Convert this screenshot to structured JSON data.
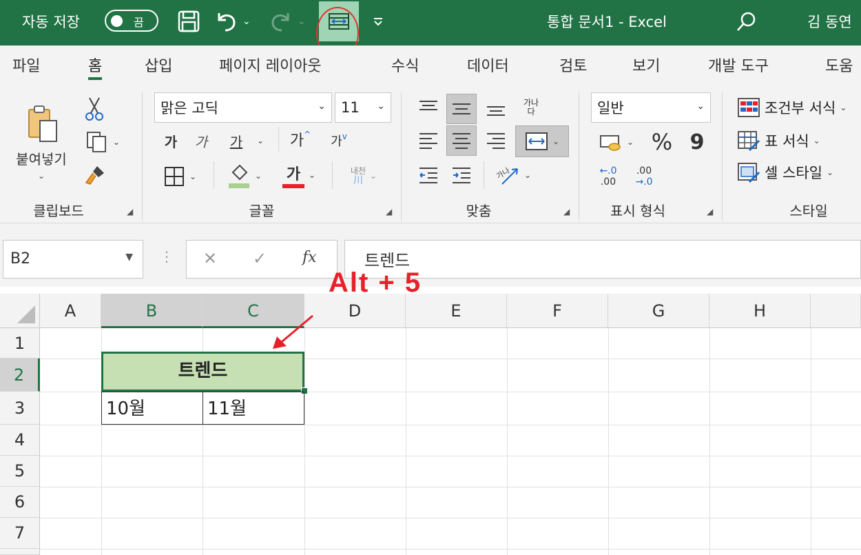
{
  "titlebar": {
    "autosave_label": "자동 저장",
    "autosave_state": "끔",
    "doc_title": "통합 문서1  -  Excel",
    "user_name": "김 동연",
    "icons": [
      "save-icon",
      "undo-icon",
      "redo-icon",
      "merge-center-icon",
      "customize-qat-icon",
      "search-icon"
    ]
  },
  "tabs": [
    "파일",
    "홈",
    "삽입",
    "페이지 레이아웃",
    "수식",
    "데이터",
    "검토",
    "보기",
    "개발 도구",
    "도움"
  ],
  "ribbon": {
    "clipboard": {
      "paste": "붙여넣기",
      "label": "클립보드"
    },
    "font": {
      "name": "맑은 고딕",
      "size": "11",
      "bold": "가",
      "italic": "가",
      "underline": "가",
      "grow": "가",
      "shrink": "가",
      "color_letter": "가",
      "phonetic_top": "내천",
      "phonetic_bottom": "川",
      "label": "글꼴"
    },
    "alignment": {
      "wrap_top": "가나",
      "wrap_bottom": "다",
      "orient": "가나",
      "label": "맞춤"
    },
    "number": {
      "format": "일반",
      "percent": "%",
      "comma": "9",
      "inc_top": "←.0",
      "inc_bottom": ".00",
      "dec_top": ".00",
      "dec_bottom": "→.0",
      "label": "표시 형식"
    },
    "styles": {
      "conditional": "조건부 서식",
      "table": "표 서식",
      "cell": "셀 스타일",
      "label": "스타일"
    }
  },
  "formula_bar": {
    "name_box": "B2",
    "fx": "fx",
    "content": "트렌드"
  },
  "grid": {
    "columns": [
      "A",
      "B",
      "C",
      "D",
      "E",
      "F",
      "G",
      "H"
    ],
    "rows": [
      "1",
      "2",
      "3",
      "4",
      "5",
      "6",
      "7"
    ],
    "merged_b2c2": "트렌드",
    "b3": "10월",
    "c3": "11월"
  },
  "annotation": "Alt  +  5",
  "colors": {
    "accent": "#217346",
    "selection_fill": "#c6e0b4",
    "annotation": "#e8202a"
  }
}
